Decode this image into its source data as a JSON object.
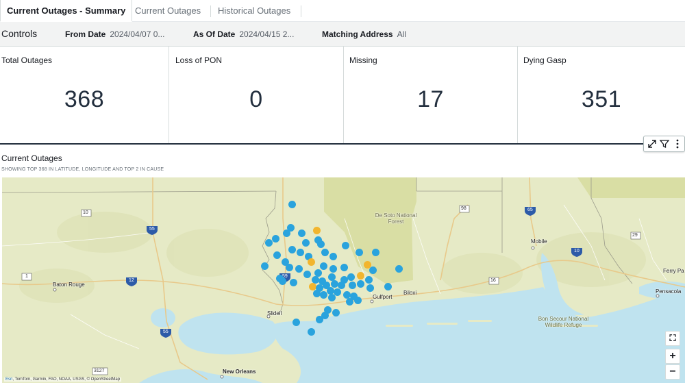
{
  "tabs": [
    {
      "label": "Current Outages - Summary",
      "active": true
    },
    {
      "label": "Current Outages",
      "active": false
    },
    {
      "label": "Historical Outages",
      "active": false
    }
  ],
  "controls": {
    "title": "Controls",
    "from_date_label": "From Date",
    "from_date_value": "2024/04/07 0...",
    "as_of_date_label": "As Of Date",
    "as_of_date_value": "2024/04/15 2...",
    "matching_address_label": "Matching Address",
    "matching_address_value": "All"
  },
  "kpis": [
    {
      "title": "Total Outages",
      "value": "368"
    },
    {
      "title": "Loss of PON",
      "value": "0"
    },
    {
      "title": "Missing",
      "value": "17"
    },
    {
      "title": "Dying Gasp",
      "value": "351"
    }
  ],
  "visual_toolbar": {
    "icons": [
      "expand-icon",
      "filter-icon",
      "more-options-icon"
    ]
  },
  "map_visual": {
    "title": "Current Outages",
    "subtitle": "SHOWING TOP 368 IN LATITUDE, LONGITUDE AND TOP 2 IN CAUSE",
    "attribution_brand": "Esri",
    "attribution_rest": ", TomTom, Garmin, FAO, NOAA, USGS, © OpenStreetMap",
    "cities": [
      "Baton Rouge",
      "Slidell",
      "New Orleans",
      "Gulfport",
      "Biloxi",
      "Mobile",
      "Pensacola",
      "Ferry Pa"
    ],
    "areas": [
      "De Soto National Forest",
      "Bon Secour National Wildlife Refuge"
    ],
    "road_shields": [
      "10",
      "55",
      "1",
      "12",
      "59",
      "98",
      "65",
      "10",
      "16",
      "29",
      "55",
      "3127"
    ],
    "marker_colors": {
      "primary": "#2aa3dd",
      "secondary": "#f2b52e"
    },
    "controls": {
      "recenter": "⛶",
      "zoom_in": "+",
      "zoom_out": "−"
    }
  }
}
